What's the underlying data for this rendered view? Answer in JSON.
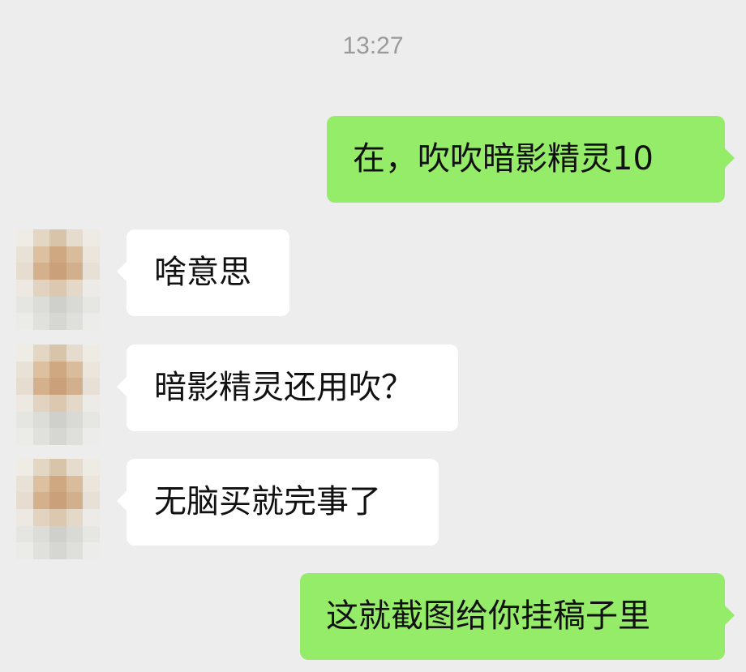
{
  "chat": {
    "timestamp": "13:27",
    "messages": [
      {
        "sender": "me",
        "text": "在，吹吹暗影精灵10"
      },
      {
        "sender": "contact",
        "text": "啥意思"
      },
      {
        "sender": "contact",
        "text": "暗影精灵还用吹？"
      },
      {
        "sender": "contact",
        "text": "无脑买就完事了"
      },
      {
        "sender": "me",
        "text": "这就截图给你挂稿子里"
      }
    ]
  },
  "colors": {
    "background": "#ededed",
    "outgoing_bubble": "#95ec69",
    "incoming_bubble": "#ffffff",
    "timestamp_text": "#9a9a9a"
  },
  "icons": {
    "contact_avatar": "pixelated-avatar-icon"
  }
}
